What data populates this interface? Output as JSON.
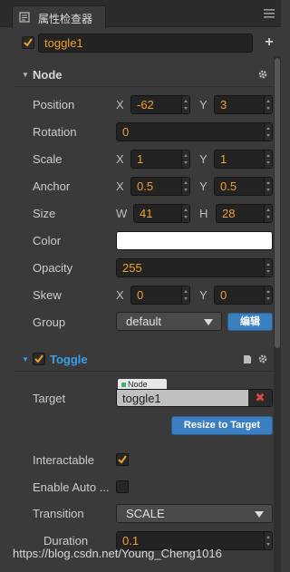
{
  "tab": {
    "title": "属性检查器",
    "icon": "inspector-icon"
  },
  "node_name": {
    "value": "toggle1",
    "checked": true
  },
  "sections": {
    "node": {
      "title": "Node"
    },
    "toggle": {
      "title": "Toggle",
      "checked": true
    }
  },
  "props": {
    "position": {
      "label": "Position",
      "x_label": "X",
      "x": "-62",
      "y_label": "Y",
      "y": "3"
    },
    "rotation": {
      "label": "Rotation",
      "value": "0"
    },
    "scale": {
      "label": "Scale",
      "x_label": "X",
      "x": "1",
      "y_label": "Y",
      "y": "1"
    },
    "anchor": {
      "label": "Anchor",
      "x_label": "X",
      "x": "0.5",
      "y_label": "Y",
      "y": "0.5"
    },
    "size": {
      "label": "Size",
      "w_label": "W",
      "w": "41",
      "h_label": "H",
      "h": "28"
    },
    "color": {
      "label": "Color",
      "value": "#ffffff"
    },
    "opacity": {
      "label": "Opacity",
      "value": "255"
    },
    "skew": {
      "label": "Skew",
      "x_label": "X",
      "x": "0",
      "y_label": "Y",
      "y": "0"
    },
    "group": {
      "label": "Group",
      "value": "default",
      "edit_label": "编辑"
    }
  },
  "toggle_props": {
    "target": {
      "label": "Target",
      "tag": "Node",
      "value": "toggle1"
    },
    "resize_button": "Resize to Target",
    "interactable": {
      "label": "Interactable",
      "checked": true
    },
    "enable_auto": {
      "label": "Enable Auto ...",
      "checked": false
    },
    "transition": {
      "label": "Transition",
      "value": "SCALE"
    },
    "duration": {
      "label": "Duration",
      "value": "0.1"
    }
  },
  "watermark": "https://blog.csdn.net/Young_Cheng1016",
  "colors": {
    "accent": "#f0a030",
    "toggle_title": "#3d9ee8",
    "button_blue": "#3c7fc0",
    "background": "#3a3a3a"
  }
}
